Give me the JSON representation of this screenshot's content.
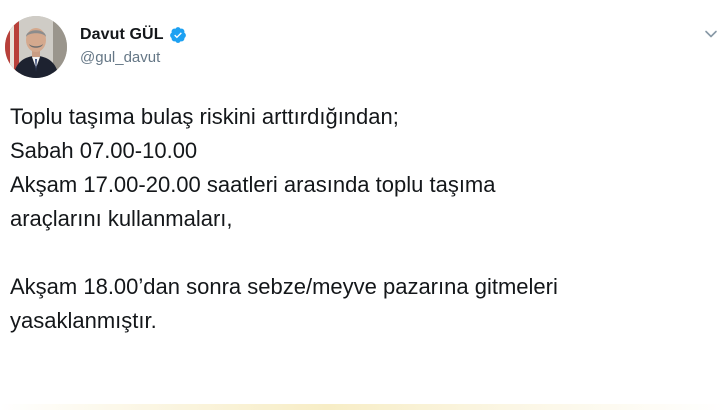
{
  "tweet": {
    "author": {
      "display_name": "Davut GÜL",
      "handle": "@gul_davut",
      "verified": true
    },
    "text_lines": [
      "Toplu taşıma bulaş riskini arttırdığından;",
      "Sabah 07.00-10.00",
      "Akşam 17.00-20.00 saatleri arasında toplu taşıma",
      "araçlarını kullanmaları,",
      "",
      "Akşam 18.00’dan sonra sebze/meyve pazarına gitmeleri",
      "yasaklanmıştır."
    ]
  },
  "icons": {
    "verified": "verified-badge-icon",
    "menu": "chevron-down-icon"
  },
  "colors": {
    "verified_blue": "#1da1f2",
    "text": "#14171a",
    "muted": "#657786"
  }
}
